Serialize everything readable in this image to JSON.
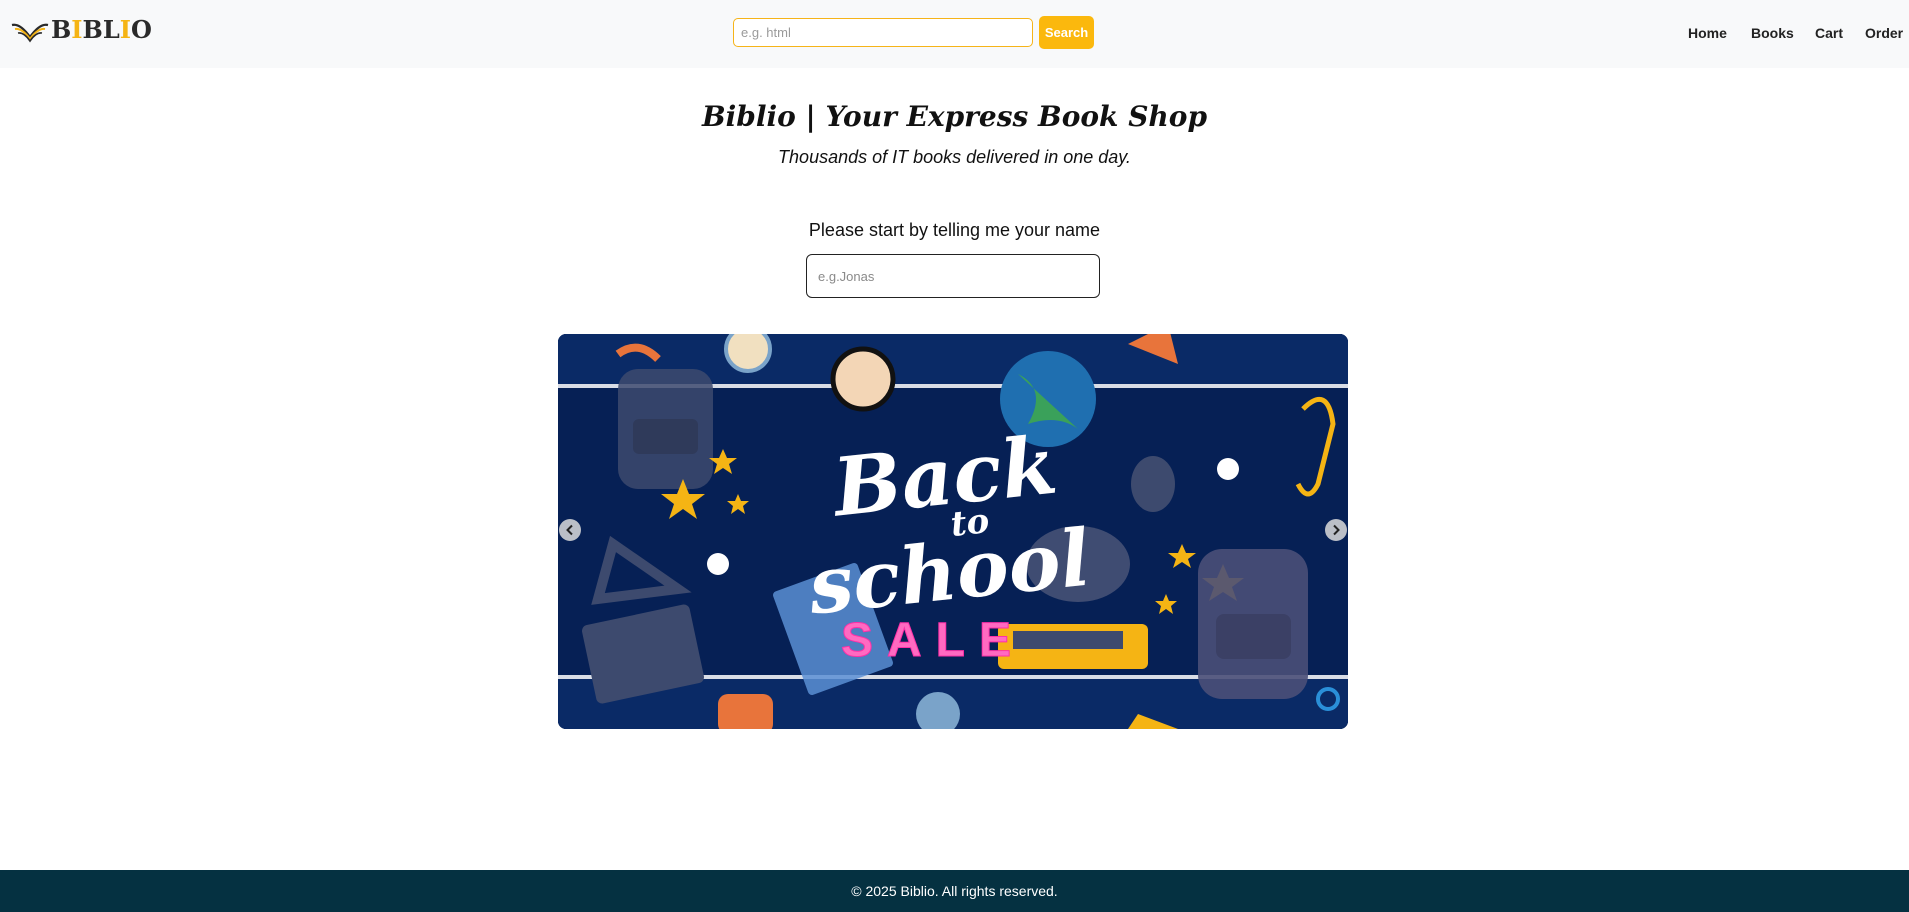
{
  "header": {
    "logo": {
      "text_prefix": "B",
      "text_accent_1": "I",
      "text_mid": "BL",
      "text_accent_2": "I",
      "text_suffix": "O",
      "icon": "open-book-icon"
    },
    "search": {
      "placeholder": "e.g. html",
      "button_label": "Search"
    },
    "nav": [
      {
        "label": "Home"
      },
      {
        "label": "Books"
      },
      {
        "label": "Cart"
      },
      {
        "label": "Order"
      }
    ]
  },
  "hero": {
    "title": "Biblio | Your Express Book Shop",
    "subtitle": "Thousands of IT books delivered in one day."
  },
  "name_form": {
    "prompt": "Please start by telling me your name",
    "placeholder": "e.g.Jonas"
  },
  "carousel": {
    "slide": {
      "headline_line1": "Back",
      "headline_line2": "to",
      "headline_line3": "school",
      "badge": "SALE"
    },
    "prev_icon": "chevron-left-icon",
    "next_icon": "chevron-right-icon"
  },
  "footer": {
    "copyright": "© 2025 Biblio. All rights reserved."
  },
  "colors": {
    "accent": "#fbb80d",
    "header_bg": "#f8f9fa",
    "footer_bg": "#053141",
    "banner_bg": "#062055",
    "sale_pink": "#ff5fb8"
  }
}
